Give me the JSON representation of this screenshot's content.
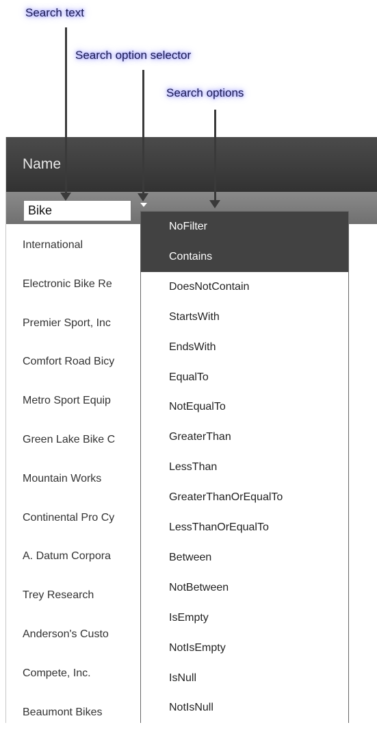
{
  "callouts": {
    "search_text": "Search text",
    "search_option_selector": "Search option selector",
    "search_options": "Search options"
  },
  "grid": {
    "header": "Name",
    "filter_value": "Bike",
    "rows": [
      "International",
      "Electronic Bike Re",
      "Premier Sport, Inc",
      "Comfort Road Bicy",
      "Metro Sport Equip",
      "Green Lake Bike C",
      "Mountain Works",
      "Continental Pro Cy",
      "A. Datum Corpora",
      "Trey Research",
      "Anderson's Custo",
      "Compete, Inc.",
      "Beaumont Bikes"
    ]
  },
  "filter_options": {
    "highlighted": [
      "NoFilter",
      "Contains"
    ],
    "items": [
      "NoFilter",
      "Contains",
      "DoesNotContain",
      "StartsWith",
      "EndsWith",
      "EqualTo",
      "NotEqualTo",
      "GreaterThan",
      "LessThan",
      "GreaterThanOrEqualTo",
      "LessThanOrEqualTo",
      "Between",
      "NotBetween",
      "IsEmpty",
      "NotIsEmpty",
      "IsNull",
      "NotIsNull"
    ]
  },
  "colors": {
    "header_bg": "#3a3a3a",
    "filter_row_bg": "#7a7a7a",
    "dropdown_active_bg": "#424242",
    "callout_glow": "#8b8bff"
  }
}
